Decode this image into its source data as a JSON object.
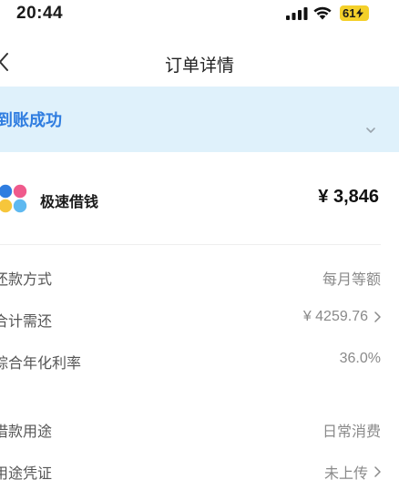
{
  "status_bar": {
    "time": "20:44",
    "battery": "61",
    "icons": [
      "cellular-signal-icon",
      "wifi-icon",
      "battery-charging-icon"
    ]
  },
  "nav": {
    "title": "订单详情",
    "back_icon": "chevron-left-icon"
  },
  "banner": {
    "status": "到账成功",
    "color": "#2f7de0",
    "background": "#dff1fb",
    "toggle_icon": "chevron-down-icon"
  },
  "loan": {
    "product_name": "极速借钱",
    "amount": "¥ 3,846",
    "logo_colors": [
      "#2f7de0",
      "#ef5a8c",
      "#f6c63b",
      "#5fb9f0"
    ]
  },
  "details": [
    {
      "label": "还款方式",
      "value": "每月等额",
      "has_arrow": false
    },
    {
      "label": "合计需还",
      "value": "¥ 4259.76",
      "has_arrow": true
    },
    {
      "label": "综合年化利率",
      "value": "36.0%",
      "has_arrow": false
    },
    {
      "label": "借款用途",
      "value": "日常消费",
      "has_arrow": false
    },
    {
      "label": "用途凭证",
      "value": "未上传",
      "has_arrow": true
    }
  ]
}
